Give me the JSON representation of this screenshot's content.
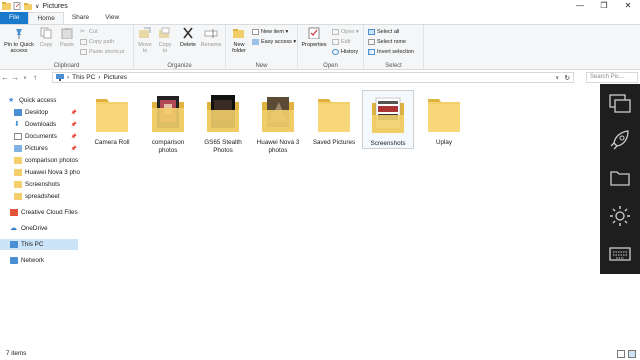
{
  "window": {
    "title": "Pictures",
    "controls": [
      "—",
      "❐",
      "✕"
    ]
  },
  "tabs": [
    "File",
    "Home",
    "Share",
    "View"
  ],
  "ribbon": {
    "clipboard": {
      "pin": "Pin to Quick access",
      "copy": "Copy",
      "paste": "Paste",
      "cut": "Cut",
      "copy_path": "Copy path",
      "paste_shortcut": "Paste shortcut",
      "label": "Clipboard"
    },
    "organize": {
      "move_to": "Move to",
      "copy_to": "Copy to",
      "delete": "Delete",
      "rename": "Rename",
      "label": "Organize"
    },
    "new": {
      "new_folder": "New folder",
      "new_item": "New item ▾",
      "easy_access": "Easy access ▾",
      "label": "New"
    },
    "open": {
      "properties": "Properties",
      "open": "Open ▾",
      "edit": "Edit",
      "history": "History",
      "label": "Open"
    },
    "select": {
      "select_all": "Select all",
      "select_none": "Select none",
      "invert": "Invert selection",
      "label": "Select"
    }
  },
  "address": {
    "crumbs": [
      "This PC",
      "Pictures"
    ],
    "search_placeholder": "Search Pic..."
  },
  "nav": {
    "quick_access": "Quick access",
    "items": [
      "Desktop",
      "Downloads",
      "Documents",
      "Pictures",
      "comparison photos",
      "Huawei Nova 3 pho",
      "Screenshots",
      "spreadsheet"
    ],
    "creative_cloud": "Creative Cloud Files",
    "onedrive": "OneDrive",
    "this_pc": "This PC",
    "network": "Network"
  },
  "folders": [
    "Camera Roll",
    "comparison photos",
    "GS65 Stealth Photos",
    "Huawei Nova 3 photos",
    "Saved Pictures",
    "Screenshots",
    "Uplay"
  ],
  "status": {
    "count": "7 items"
  },
  "colors": {
    "accent": "#1979ca",
    "folder": "#f3cf6b",
    "folder_dark": "#e0b23f",
    "sidebar": "#1e1e1e"
  }
}
